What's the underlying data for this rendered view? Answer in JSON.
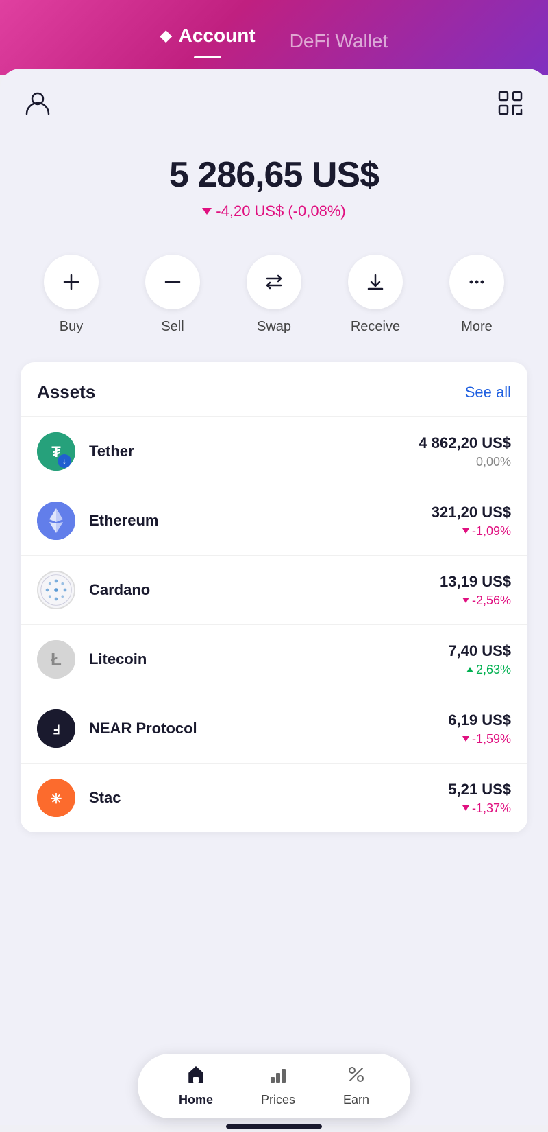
{
  "header": {
    "account_tab": "Account",
    "defi_tab": "DeFi Wallet"
  },
  "balance": {
    "amount": "5 286,65 US$",
    "change_amount": "-4,20 US$",
    "change_percent": "(-0,08%)"
  },
  "actions": [
    {
      "id": "buy",
      "label": "Buy",
      "icon": "plus"
    },
    {
      "id": "sell",
      "label": "Sell",
      "icon": "minus"
    },
    {
      "id": "swap",
      "label": "Swap",
      "icon": "swap"
    },
    {
      "id": "receive",
      "label": "Receive",
      "icon": "receive"
    },
    {
      "id": "more",
      "label": "More",
      "icon": "more"
    }
  ],
  "assets": {
    "title": "Assets",
    "see_all": "See all",
    "items": [
      {
        "name": "Tether",
        "amount": "4 862,20 US$",
        "change": "0,00%",
        "change_type": "neutral",
        "logo_type": "tether"
      },
      {
        "name": "Ethereum",
        "amount": "321,20 US$",
        "change": "-1,09%",
        "change_type": "down",
        "logo_type": "ethereum"
      },
      {
        "name": "Cardano",
        "amount": "13,19 US$",
        "change": "-2,56%",
        "change_type": "down",
        "logo_type": "cardano"
      },
      {
        "name": "Litecoin",
        "amount": "7,40 US$",
        "change": "2,63%",
        "change_type": "up",
        "logo_type": "litecoin"
      },
      {
        "name": "NEAR Protocol",
        "amount": "6,19 US$",
        "change": "-1,59%",
        "change_type": "down",
        "logo_type": "near"
      },
      {
        "name": "Stac",
        "amount": "5,21 US$",
        "change": "-1,37%",
        "change_type": "down",
        "logo_type": "stacks"
      }
    ]
  },
  "bottom_nav": {
    "items": [
      {
        "id": "home",
        "label": "Home",
        "icon": "house",
        "active": true
      },
      {
        "id": "prices",
        "label": "Prices",
        "icon": "chart",
        "active": false
      },
      {
        "id": "earn",
        "label": "Earn",
        "icon": "percent",
        "active": false
      }
    ]
  }
}
